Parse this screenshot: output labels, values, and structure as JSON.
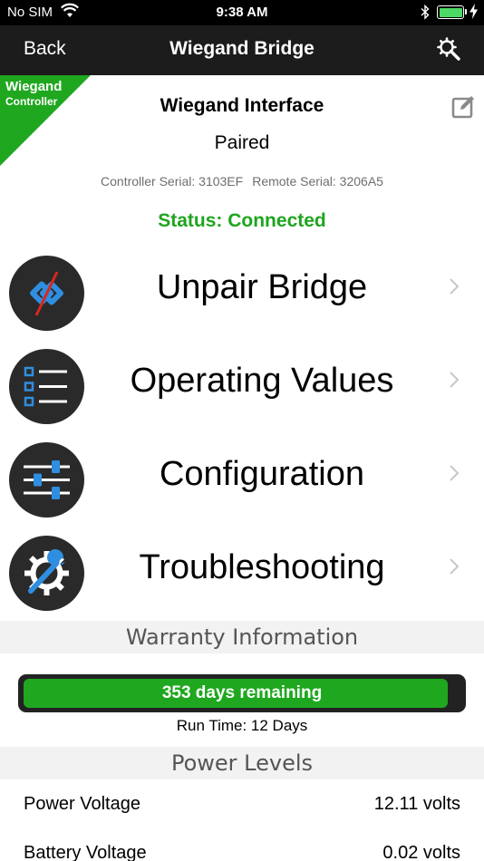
{
  "status_bar": {
    "carrier": "No SIM",
    "time": "9:38 AM",
    "battery_level": 1.0,
    "battery_color": "#4cd964"
  },
  "nav": {
    "back_label": "Back",
    "title": "Wiegand Bridge",
    "settings_icon": "gear-search-icon"
  },
  "ribbon": {
    "line1": "Wiegand",
    "line2": "Controller",
    "color": "#1fa81f"
  },
  "device": {
    "name": "Wiegand Interface",
    "pair_state": "Paired",
    "controller_serial": "Controller Serial: 3103EF",
    "remote_serial": "Remote Serial: 3206A5",
    "status": "Status: Connected",
    "status_color": "#1ea51e"
  },
  "menu": [
    {
      "label": "Unpair Bridge",
      "icon": "unlink-icon"
    },
    {
      "label": "Operating Values",
      "icon": "list-icon"
    },
    {
      "label": "Configuration",
      "icon": "sliders-icon"
    },
    {
      "label": "Troubleshooting",
      "icon": "wrench-gear-icon"
    }
  ],
  "warranty": {
    "header": "Warranty Information",
    "remaining_text": "353 days remaining",
    "remaining_fraction": 0.97,
    "run_time": "Run Time: 12 Days"
  },
  "power": {
    "header": "Power Levels",
    "rows": [
      {
        "name": "Power Voltage",
        "value": "12.11 volts"
      },
      {
        "name": "Battery Voltage",
        "value": "0.02 volts"
      }
    ]
  },
  "colors": {
    "accent_blue": "#2f8ee0",
    "icon_bg": "#2a2a2a",
    "nav_bg": "#1c1c1c"
  }
}
